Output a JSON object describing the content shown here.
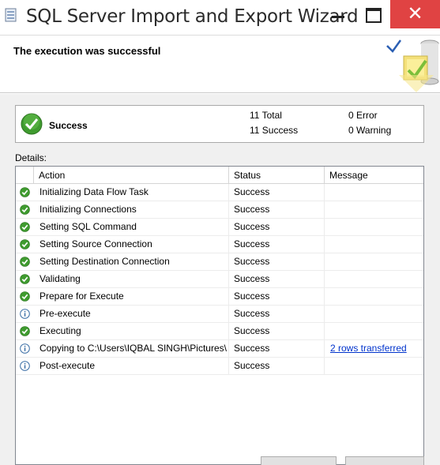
{
  "window": {
    "title": "SQL Server Import and Export Wizard",
    "close_glyph": "✕"
  },
  "header": {
    "title": "The execution was successful"
  },
  "summary": {
    "status": "Success",
    "total": "11 Total",
    "success": "11 Success",
    "error": "0 Error",
    "warning": "0 Warning"
  },
  "details": {
    "label": "Details:",
    "columns": [
      "Action",
      "Status",
      "Message"
    ],
    "rows": [
      {
        "icon": "success-check-icon",
        "action": "Initializing Data Flow Task",
        "status": "Success",
        "message": ""
      },
      {
        "icon": "success-check-icon",
        "action": "Initializing Connections",
        "status": "Success",
        "message": ""
      },
      {
        "icon": "success-check-icon",
        "action": "Setting SQL Command",
        "status": "Success",
        "message": ""
      },
      {
        "icon": "success-check-icon",
        "action": "Setting Source Connection",
        "status": "Success",
        "message": ""
      },
      {
        "icon": "success-check-icon",
        "action": "Setting Destination Connection",
        "status": "Success",
        "message": ""
      },
      {
        "icon": "success-check-icon",
        "action": "Validating",
        "status": "Success",
        "message": ""
      },
      {
        "icon": "success-check-icon",
        "action": "Prepare for Execute",
        "status": "Success",
        "message": ""
      },
      {
        "icon": "info-icon",
        "action": "Pre-execute",
        "status": "Success",
        "message": ""
      },
      {
        "icon": "success-check-icon",
        "action": "Executing",
        "status": "Success",
        "message": ""
      },
      {
        "icon": "info-icon",
        "action": "Copying to C:\\Users\\IQBAL SINGH\\Pictures\\...",
        "status": "Success",
        "message": "2 rows transferred"
      },
      {
        "icon": "info-icon",
        "action": "Post-execute",
        "status": "Success",
        "message": ""
      }
    ]
  },
  "colors": {
    "close_button": "#e04343",
    "success_green": "#3f9b2f",
    "info_blue": "#3a6ea5",
    "link_blue": "#0033cc"
  }
}
